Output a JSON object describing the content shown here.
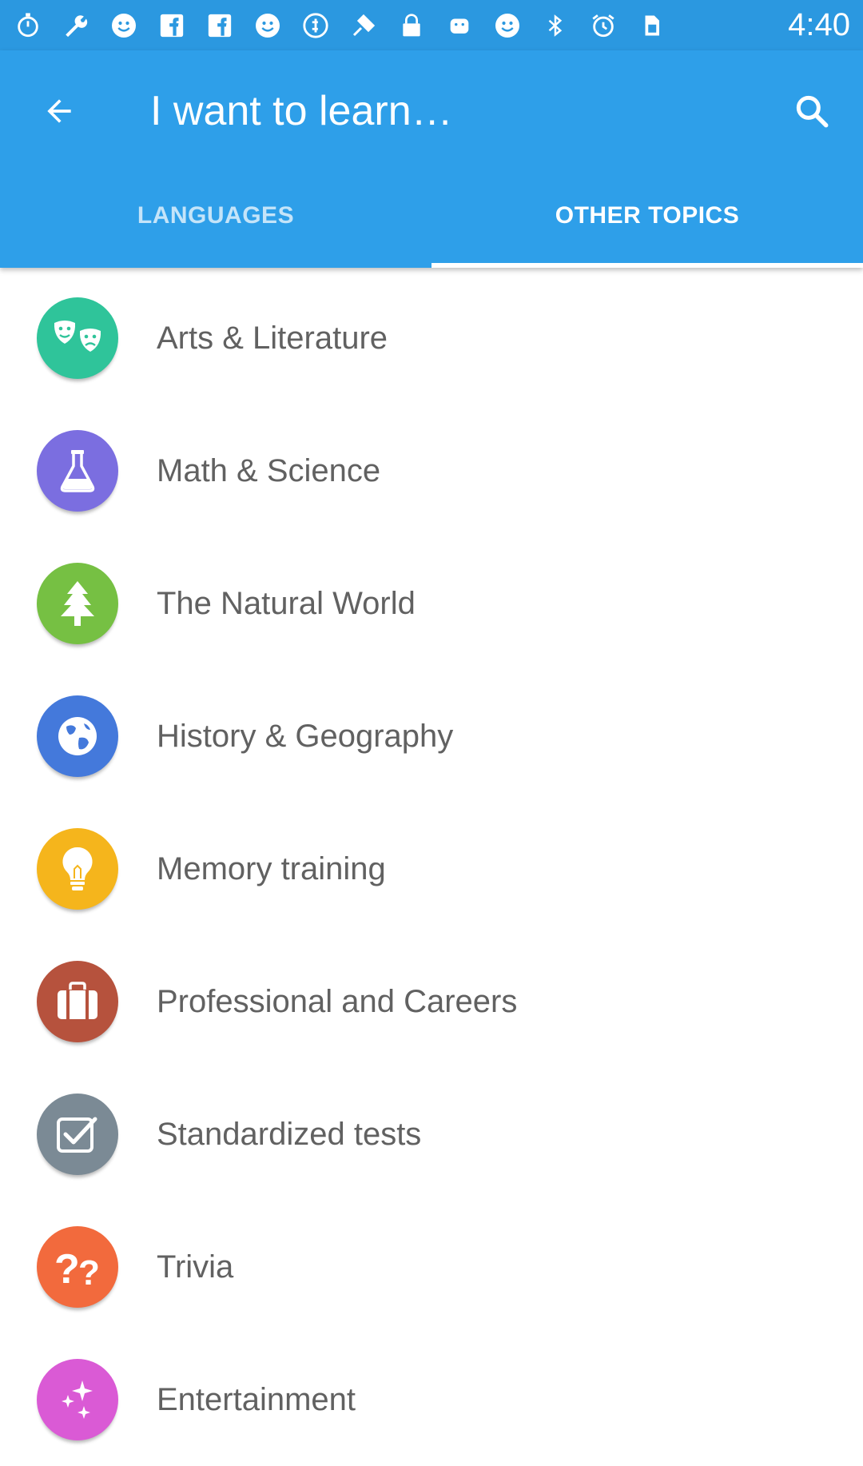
{
  "status_bar": {
    "time": "4:40",
    "icons": [
      "stopwatch-icon",
      "wrench-icon",
      "smiley-icon",
      "facebook-icon",
      "facebook-icon",
      "smiley-icon",
      "coin-icon",
      "fake-gps-icon",
      "lock-icon",
      "android-icon",
      "smiley-icon",
      "bluetooth-icon",
      "alarm-icon",
      "sim-icon"
    ]
  },
  "app_bar": {
    "title": "I want to learn…",
    "background": "#2e9fe9"
  },
  "tabs": [
    {
      "label": "LANGUAGES",
      "selected": false
    },
    {
      "label": "OTHER TOPICS",
      "selected": true
    }
  ],
  "topics": [
    {
      "label": "Arts & Literature",
      "icon": "theater-masks-icon",
      "color": "#2fc49a"
    },
    {
      "label": "Math & Science",
      "icon": "flask-icon",
      "color": "#7b6ee0"
    },
    {
      "label": "The Natural World",
      "icon": "tree-icon",
      "color": "#76c043"
    },
    {
      "label": "History & Geography",
      "icon": "globe-icon",
      "color": "#4479db"
    },
    {
      "label": "Memory training",
      "icon": "lightbulb-icon",
      "color": "#f5b51c"
    },
    {
      "label": "Professional and Careers",
      "icon": "briefcase-icon",
      "color": "#b6523d"
    },
    {
      "label": "Standardized tests",
      "icon": "checkbox-icon",
      "color": "#7b8a95"
    },
    {
      "label": "Trivia",
      "icon": "question-marks-icon",
      "color": "#f26a3d"
    },
    {
      "label": "Entertainment",
      "icon": "sparkles-icon",
      "color": "#da5ad5"
    }
  ]
}
